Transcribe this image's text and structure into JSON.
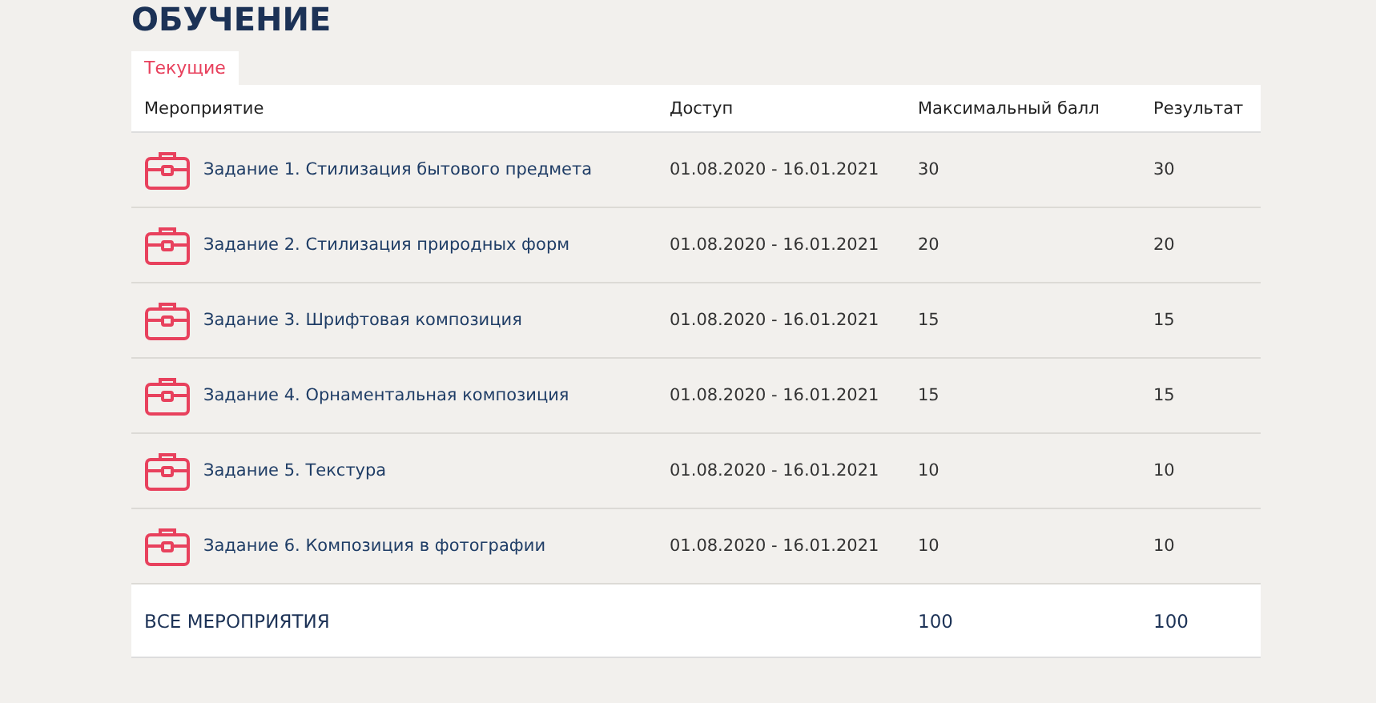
{
  "title": "ОБУЧЕНИЕ",
  "tabs": [
    {
      "label": "Текущие",
      "selected": true
    }
  ],
  "table": {
    "columns": [
      "Мероприятие",
      "Доступ",
      "Максимальный балл",
      "Результат"
    ],
    "rows": [
      {
        "name": "Задание 1. Стилизация бытового предмета",
        "access": "01.08.2020 - 16.01.2021",
        "max": "30",
        "result": "30"
      },
      {
        "name": "Задание 2. Стилизация природных форм",
        "access": "01.08.2020 - 16.01.2021",
        "max": "20",
        "result": "20"
      },
      {
        "name": "Задание 3. Шрифтовая композиция",
        "access": "01.08.2020 - 16.01.2021",
        "max": "15",
        "result": "15"
      },
      {
        "name": "Задание 4. Орнаментальная композиция",
        "access": "01.08.2020 - 16.01.2021",
        "max": "15",
        "result": "15"
      },
      {
        "name": "Задание 5. Текстура",
        "access": "01.08.2020 - 16.01.2021",
        "max": "10",
        "result": "10"
      },
      {
        "name": "Задание 6. Композиция в фотографии",
        "access": "01.08.2020 - 16.01.2021",
        "max": "10",
        "result": "10"
      }
    ],
    "total": {
      "label": "ВСЕ МЕРОПРИЯТИЯ",
      "max": "100",
      "result": "100"
    }
  }
}
